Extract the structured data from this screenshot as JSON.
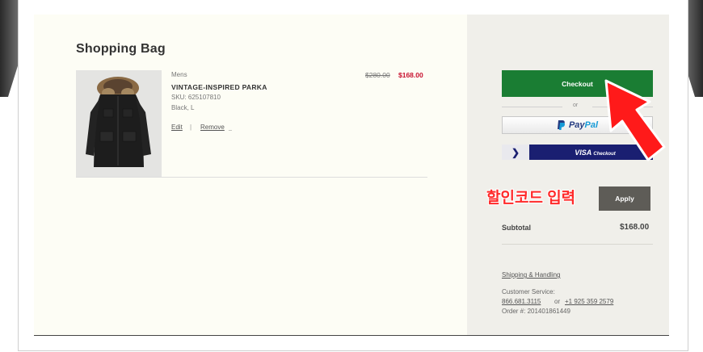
{
  "page": {
    "title": "Shopping Bag"
  },
  "item": {
    "category": "Mens",
    "name": "VINTAGE-INSPIRED PARKA",
    "sku": "SKU: 625107810",
    "variant": "Black, L",
    "edit_label": "Edit",
    "separator": "|",
    "remove_label": "Remove",
    "remove_caret": "_",
    "original_price": "$280.00",
    "sale_price": "$168.00"
  },
  "checkout": {
    "checkout_label": "Checkout",
    "or_label": "or",
    "paypal_label_a": "Pay",
    "paypal_label_b": "Pal",
    "visa_chevron": "❯",
    "visa_label": "VISA",
    "visa_sublabel": "Checkout"
  },
  "promo": {
    "annotation": "할인코드 입력",
    "apply_label": "Apply"
  },
  "totals": {
    "subtotal_label": "Subtotal",
    "subtotal_value": "$168.00"
  },
  "support": {
    "shipping_link": "Shipping & Handling",
    "customer_service_label": "Customer Service:",
    "phone_primary": "866.681.3115",
    "or_label": "or",
    "phone_secondary": "+1 925 359 2579",
    "order_number": "Order #: 201401861449"
  },
  "colors": {
    "checkout_green": "#1a7d33",
    "sale_red": "#c8102e",
    "visa_navy": "#1a1f71",
    "annotation_red": "#ff2a2a",
    "apply_gray": "#5e5c57"
  },
  "icons": {
    "annotation_arrow": "red-arrow-icon",
    "paypal": "paypal-logo-icon",
    "visa_chevron": "chevron-right-icon"
  }
}
